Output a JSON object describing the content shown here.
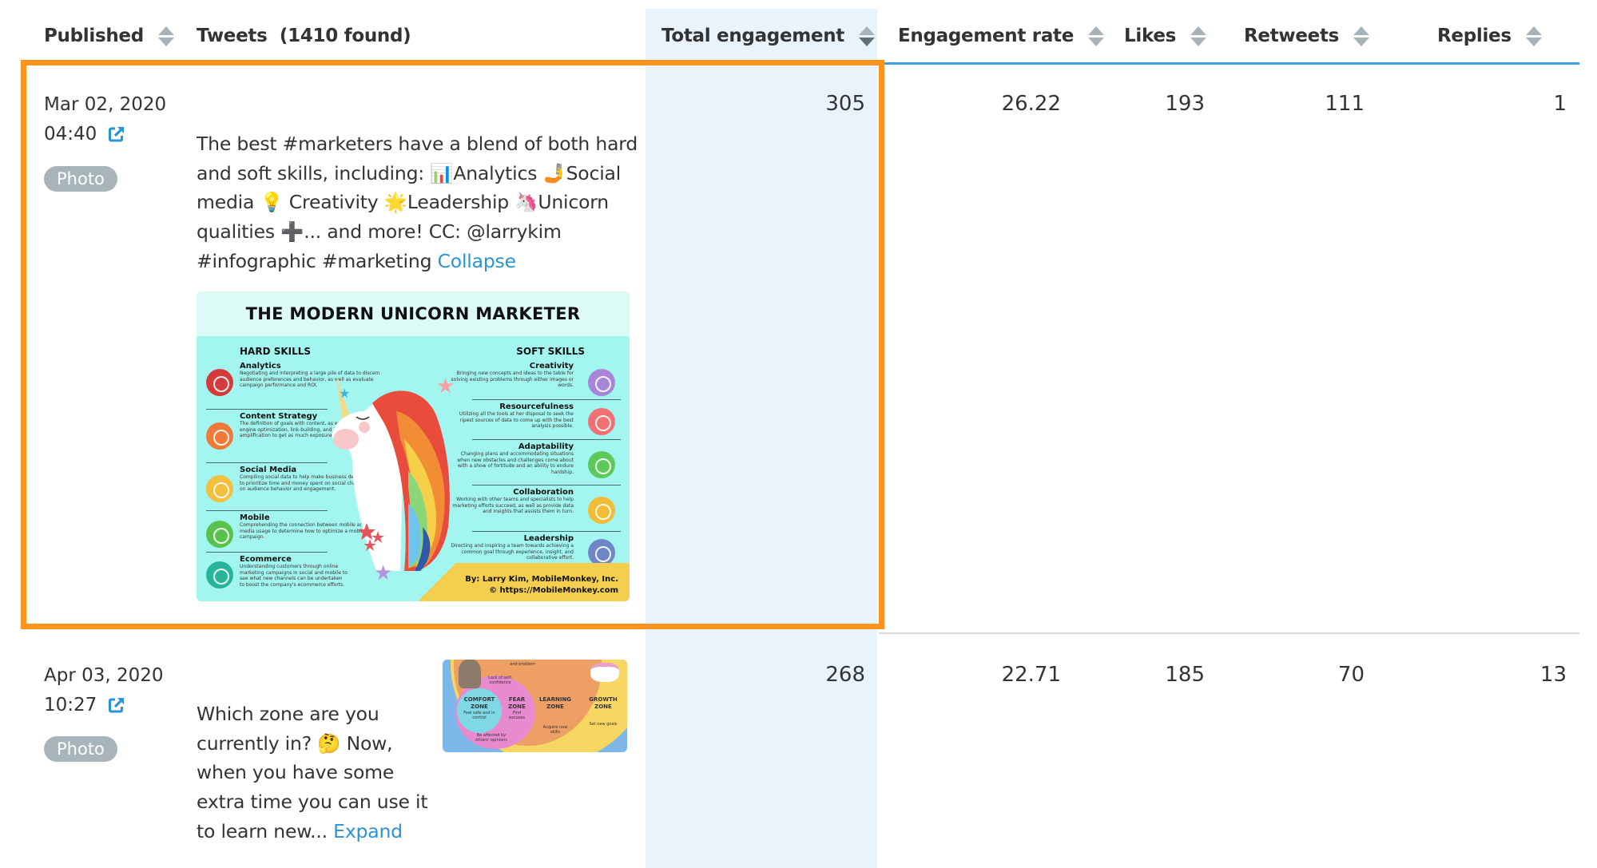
{
  "table": {
    "columns": [
      {
        "key": "published",
        "label": "Published",
        "sortable": true,
        "active_sort": false
      },
      {
        "key": "tweets",
        "label": "Tweets  (1410 found)",
        "sortable": false
      },
      {
        "key": "total_engagement",
        "label": "Total engagement",
        "sortable": true,
        "active_sort": true,
        "sort_direction": "descending"
      },
      {
        "key": "engagement_rate",
        "label": "Engagement rate",
        "sortable": true,
        "active_sort": false
      },
      {
        "key": "likes",
        "label": "Likes",
        "sortable": true,
        "active_sort": false
      },
      {
        "key": "retweets",
        "label": "Retweets",
        "sortable": true,
        "active_sort": false
      },
      {
        "key": "replies",
        "label": "Replies",
        "sortable": true,
        "active_sort": false
      }
    ],
    "tweets_found": 1410,
    "rows": [
      {
        "date": "Mar 02, 2020",
        "time": "04:40",
        "type_badge": "Photo",
        "text": "The best #marketers have a blend of both hard and soft skills, including: 📊Analytics 🤳Social media 💡 Creativity 🌟Leadership 🦄Unicorn qualities ➕... and more! CC: @larrykim #infographic #marketing",
        "text_lines": [
          "The best #marketers have a blend of both hard",
          "and soft skills, including: 📊Analytics 🤳Social",
          "media 💡 Creativity 🌟Leadership 🦄Unicorn",
          "qualities ➕... and more! CC: @larrykim",
          "#infographic #marketing "
        ],
        "toggle_link": "Collapse",
        "highlighted": true,
        "total_engagement": "305",
        "engagement_rate": "26.22",
        "likes": "193",
        "retweets": "111",
        "replies": "1",
        "image": {
          "title": "THE MODERN UNICORN MARKETER",
          "hard_skills_heading": "HARD SKILLS",
          "soft_skills_heading": "SOFT SKILLS",
          "hard_skills": [
            {
              "name": "Analytics",
              "desc": "Negotiating and interpreting a large pile of data to discern audience preferences and behavior, as well as evaluate campaign performance and ROI.",
              "color": "#d63b3b"
            },
            {
              "name": "Content Strategy",
              "desc": "The definition of goals with content, as well as using search engine optimization, link-building, and best practices in amplification to get as much exposure for content as possible.",
              "color": "#ef7a37"
            },
            {
              "name": "Social Media",
              "desc": "Compiling social data to help make business decisions on how to prioritize time and money spent on social channels based on audience behavior and engagement.",
              "color": "#f2bf3e"
            },
            {
              "name": "Mobile",
              "desc": "Comprehending the connection between mobile and social media usage to determine how to optimize a mobile marketing campaign.",
              "color": "#58c24f"
            },
            {
              "name": "Ecommerce",
              "desc": "Understanding customers through online marketing campaigns in social and mobile to see what new channels can be undertaken to boost the company's ecommerce efforts.",
              "color": "#27b59a"
            }
          ],
          "soft_skills": [
            {
              "name": "Creativity",
              "desc": "Bringing new concepts and ideas to the table for solving existing problems through either images or words.",
              "color": "#a785d8"
            },
            {
              "name": "Resourcefulness",
              "desc": "Utilizing all the tools at her disposal to seek the ripest sources of data to come up with the best analysis possible.",
              "color": "#f26f73"
            },
            {
              "name": "Adaptability",
              "desc": "Changing plans and accommodating situations when new obstacles and challenges come about with a show of fortitude and an ability to endure hardship.",
              "color": "#5dc95a"
            },
            {
              "name": "Collaboration",
              "desc": "Working with other teams and specialists to help marketing efforts succeed, as well as provide data and insights that assists them in turn.",
              "color": "#f2bd35"
            },
            {
              "name": "Leadership",
              "desc": "Directing and inspiring a team towards achieving a common goal through experience, insight, and collaborative effort.",
              "color": "#6f86c4"
            }
          ],
          "credit_line1": "By: Larry Kim, MobileMonkey, Inc.",
          "credit_line2": "© https://MobileMonkey.com"
        }
      },
      {
        "date": "Apr 03, 2020",
        "time": "10:27",
        "type_badge": "Photo",
        "text": "Which zone are you currently in? 🤔 Now, when you have some extra time you can use it to learn new...",
        "text_lines": [
          "Which zone are you",
          "currently in? 🤔 Now,",
          "when you have some",
          "extra time you can use it",
          "to learn new... "
        ],
        "toggle_link": "Expand",
        "highlighted": false,
        "total_engagement": "268",
        "engagement_rate": "22.71",
        "likes": "185",
        "retweets": "70",
        "replies": "13",
        "image": {
          "zones": [
            {
              "name": "COMFORT ZONE",
              "desc": "Feel safe and in control"
            },
            {
              "name": "FEAR ZONE",
              "desc": "Find excuses"
            },
            {
              "name": "LEARNING ZONE",
              "desc": "Acquire new skills"
            },
            {
              "name": "GROWTH ZONE",
              "desc": "Set new goals"
            }
          ],
          "annotations": [
            "and problem",
            "Lack of self-confidence",
            "Be affected by others' opinions"
          ]
        }
      }
    ]
  },
  "colors": {
    "accent_blue": "#3d9ee0",
    "link_blue": "#2a93d5",
    "highlight_orange": "#ff931e",
    "active_column_bg": "#e8f3fc",
    "badge_gray": "#a7b5bb",
    "sort_icon": "#a6b3b9",
    "sort_icon_active": "#5f7177"
  },
  "icons": {
    "sort": "sort-up-down-icon",
    "external_link": "external-link-icon"
  }
}
